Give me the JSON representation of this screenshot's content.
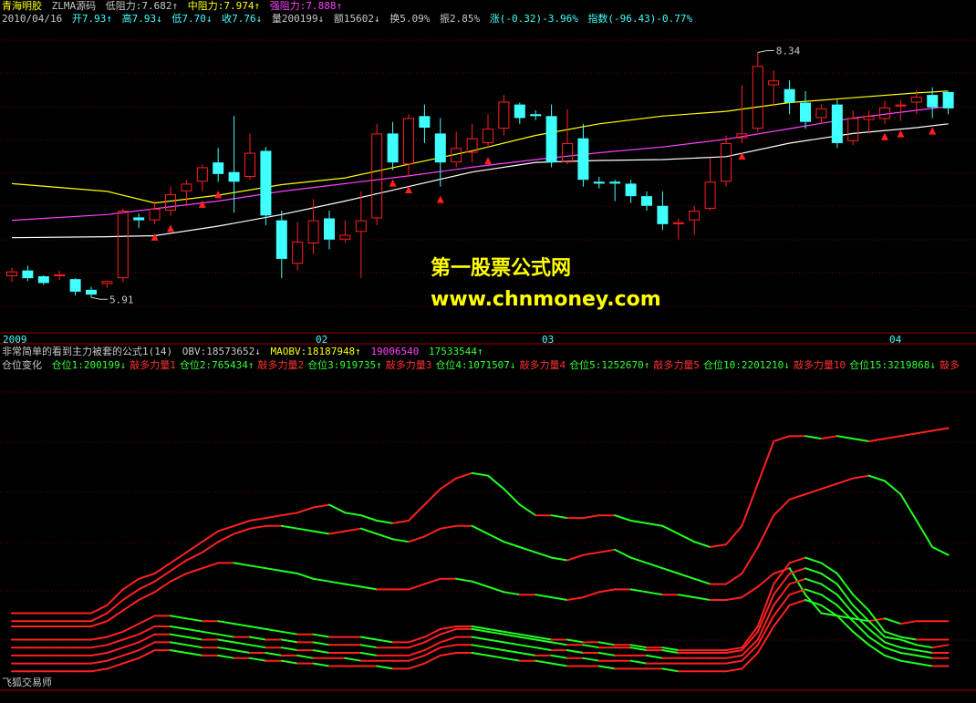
{
  "header1": {
    "stock_name": "青海明胶",
    "indicator_name": "ZLMA源码",
    "low_res": "低阻力:7.682↑",
    "mid_res": "中阻力:7.974↑",
    "strong_res": "强阻力:7.888↑"
  },
  "header2": {
    "date": "2010/04/16",
    "open": "开7.93↑",
    "high": "高7.93↓",
    "low": "低7.70↓",
    "close": "收7.76↓",
    "volume": "量200199↓",
    "amount": "额15602↓",
    "turnover": "换5.09%",
    "amplitude": "振2.85%",
    "change": "涨(-0.32)-3.96%",
    "index": "指数(-96.43)-0.77%"
  },
  "header3": {
    "formula": "非常简单的看到主力被套的公式1(14)",
    "obv": "OBV:18573652↓",
    "maobv": "MAOBV:18187948↑",
    "v1": "19006540",
    "v2": "17533544↑"
  },
  "header4": {
    "title": "仓位变化",
    "items": [
      {
        "text": "仓位1:200199↓",
        "color": "g"
      },
      {
        "text": "敲多力量1",
        "color": "r"
      },
      {
        "text": "仓位2:765434↑",
        "color": "g"
      },
      {
        "text": "敲多力量2",
        "color": "r"
      },
      {
        "text": "仓位3:919735↑",
        "color": "g"
      },
      {
        "text": "敲多力量3",
        "color": "r"
      },
      {
        "text": "仓位4:1071507↓",
        "color": "g"
      },
      {
        "text": "敲多力量4",
        "color": "r"
      },
      {
        "text": "仓位5:1252670↑",
        "color": "g"
      },
      {
        "text": "敲多力量5",
        "color": "r"
      },
      {
        "text": "仓位10:2201210↓",
        "color": "g"
      },
      {
        "text": "敲多力量10",
        "color": "r"
      },
      {
        "text": "仓位15:3219868↓",
        "color": "g"
      },
      {
        "text": "敲多",
        "color": "r"
      }
    ]
  },
  "watermark": {
    "line1": "第一股票公式网",
    "line2": "www.chnmoney.com"
  },
  "footer": "飞狐交易师",
  "chart_data": [
    {
      "type": "candlestick",
      "price_labels": {
        "high": "8.34",
        "low": "5.91"
      },
      "x_labels": [
        "2009",
        "02",
        "03",
        "04"
      ],
      "ylim": [
        5.5,
        8.6
      ],
      "colors": {
        "up": "#ff2020",
        "down": "#40ffff",
        "ma_short": "#ffff00",
        "ma_mid": "#ff40ff",
        "ma_long": "#ffffff",
        "marker": "#ff2020"
      },
      "candles": [
        [
          6.02,
          6.07,
          6.11,
          5.96
        ],
        [
          6.08,
          6.0,
          6.13,
          5.97
        ],
        [
          6.02,
          5.95,
          6.03,
          5.93
        ],
        [
          6.02,
          6.04,
          6.08,
          5.98
        ],
        [
          5.99,
          5.86,
          6.0,
          5.82
        ],
        [
          5.88,
          5.83,
          5.91,
          5.8
        ],
        [
          5.94,
          5.97,
          5.98,
          5.9
        ],
        [
          6.0,
          6.7,
          6.72,
          5.96
        ],
        [
          6.63,
          6.6,
          6.67,
          6.52
        ],
        [
          6.6,
          6.72,
          6.8,
          6.56
        ],
        [
          6.7,
          6.87,
          6.95,
          6.65
        ],
        [
          6.9,
          6.98,
          7.02,
          6.75
        ],
        [
          7.0,
          7.15,
          7.18,
          6.9
        ],
        [
          7.2,
          7.08,
          7.35,
          7.0
        ],
        [
          7.1,
          7.0,
          7.68,
          6.68
        ],
        [
          7.05,
          7.3,
          7.5,
          7.02
        ],
        [
          7.32,
          6.65,
          7.36,
          6.55
        ],
        [
          6.6,
          6.2,
          6.7,
          6.0
        ],
        [
          6.15,
          6.38,
          6.58,
          6.08
        ],
        [
          6.36,
          6.6,
          6.82,
          6.25
        ],
        [
          6.62,
          6.4,
          6.7,
          6.3
        ],
        [
          6.4,
          6.45,
          6.6,
          6.37
        ],
        [
          6.48,
          6.6,
          6.9,
          6.0
        ],
        [
          6.62,
          7.5,
          7.6,
          6.55
        ],
        [
          7.5,
          7.2,
          7.62,
          7.12
        ],
        [
          7.18,
          7.66,
          7.7,
          7.05
        ],
        [
          7.68,
          7.56,
          7.8,
          7.4
        ],
        [
          7.5,
          7.2,
          7.66,
          6.95
        ],
        [
          7.2,
          7.35,
          7.52,
          7.15
        ],
        [
          7.3,
          7.45,
          7.6,
          7.2
        ],
        [
          7.4,
          7.55,
          7.7,
          7.35
        ],
        [
          7.55,
          7.83,
          7.9,
          7.48
        ],
        [
          7.8,
          7.66,
          7.82,
          7.6
        ],
        [
          7.7,
          7.68,
          7.74,
          7.64
        ],
        [
          7.68,
          7.2,
          7.8,
          7.15
        ],
        [
          7.2,
          7.4,
          7.75,
          7.18
        ],
        [
          7.45,
          7.02,
          7.6,
          6.95
        ],
        [
          7.0,
          6.98,
          7.05,
          6.93
        ],
        [
          7.0,
          6.98,
          7.02,
          6.8
        ],
        [
          6.98,
          6.85,
          7.02,
          6.78
        ],
        [
          6.85,
          6.75,
          6.9,
          6.7
        ],
        [
          6.75,
          6.56,
          6.9,
          6.5
        ],
        [
          6.56,
          6.58,
          6.62,
          6.4
        ],
        [
          6.6,
          6.7,
          6.75,
          6.45
        ],
        [
          6.72,
          7.0,
          7.25,
          6.7
        ],
        [
          7.0,
          7.4,
          7.48,
          6.95
        ],
        [
          7.45,
          7.5,
          8.0,
          7.4
        ],
        [
          7.55,
          8.2,
          8.34,
          7.52
        ],
        [
          8.0,
          8.05,
          8.15,
          7.8
        ],
        [
          7.96,
          7.82,
          8.05,
          7.7
        ],
        [
          7.82,
          7.62,
          7.94,
          7.55
        ],
        [
          7.66,
          7.76,
          7.8,
          7.6
        ],
        [
          7.8,
          7.4,
          7.85,
          7.35
        ],
        [
          7.42,
          7.66,
          7.74,
          7.38
        ],
        [
          7.64,
          7.68,
          7.74,
          7.5
        ],
        [
          7.65,
          7.77,
          7.84,
          7.6
        ],
        [
          7.78,
          7.8,
          7.85,
          7.63
        ],
        [
          7.82,
          7.88,
          7.95,
          7.7
        ],
        [
          7.9,
          7.77,
          7.98,
          7.66
        ],
        [
          7.93,
          7.76,
          7.93,
          7.7
        ]
      ],
      "ma_short": [
        [
          0,
          6.98
        ],
        [
          6,
          6.9
        ],
        [
          9,
          6.78
        ],
        [
          13,
          6.86
        ],
        [
          17,
          6.97
        ],
        [
          21,
          7.04
        ],
        [
          25,
          7.18
        ],
        [
          29,
          7.32
        ],
        [
          33,
          7.48
        ],
        [
          37,
          7.6
        ],
        [
          41,
          7.68
        ],
        [
          45,
          7.73
        ],
        [
          49,
          7.82
        ],
        [
          53,
          7.87
        ],
        [
          57,
          7.92
        ],
        [
          59,
          7.94
        ]
      ],
      "ma_mid": [
        [
          0,
          6.6
        ],
        [
          6,
          6.66
        ],
        [
          9,
          6.72
        ],
        [
          13,
          6.8
        ],
        [
          17,
          6.9
        ],
        [
          21,
          6.98
        ],
        [
          25,
          7.06
        ],
        [
          29,
          7.15
        ],
        [
          33,
          7.23
        ],
        [
          37,
          7.3
        ],
        [
          41,
          7.36
        ],
        [
          45,
          7.44
        ],
        [
          49,
          7.55
        ],
        [
          53,
          7.66
        ],
        [
          57,
          7.74
        ],
        [
          59,
          7.78
        ]
      ],
      "ma_long": [
        [
          0,
          6.42
        ],
        [
          6,
          6.43
        ],
        [
          9,
          6.44
        ],
        [
          13,
          6.54
        ],
        [
          17,
          6.66
        ],
        [
          21,
          6.8
        ],
        [
          25,
          6.95
        ],
        [
          29,
          7.1
        ],
        [
          33,
          7.2
        ],
        [
          37,
          7.22
        ],
        [
          41,
          7.23
        ],
        [
          45,
          7.26
        ],
        [
          49,
          7.4
        ],
        [
          53,
          7.5
        ],
        [
          57,
          7.56
        ],
        [
          59,
          7.6
        ]
      ],
      "markers": [
        9,
        10,
        12,
        13,
        24,
        25,
        27,
        30,
        46,
        55,
        56,
        58
      ]
    },
    {
      "type": "line",
      "ylim": [
        0,
        100
      ],
      "colors": {
        "rising": "#ff2020",
        "falling": "#20ff20"
      },
      "series": [
        {
          "values": [
            25,
            25,
            25,
            25,
            25,
            25,
            28,
            34,
            38,
            40,
            44,
            48,
            52,
            56,
            58,
            60,
            61,
            62,
            63,
            65,
            66,
            63,
            62,
            60,
            59,
            60,
            66,
            72,
            76,
            78,
            77,
            72,
            66,
            62,
            62,
            61,
            61,
            62,
            62,
            60,
            59,
            58,
            55,
            52,
            50,
            51,
            58,
            74,
            90,
            92,
            92,
            91,
            92,
            91,
            90,
            91,
            92,
            93,
            94,
            95
          ]
        },
        {
          "values": [
            22,
            22,
            22,
            22,
            22,
            22,
            25,
            30,
            34,
            37,
            41,
            45,
            48,
            52,
            55,
            57,
            58,
            58,
            57,
            56,
            55,
            56,
            57,
            55,
            53,
            52,
            54,
            57,
            58,
            58,
            55,
            52,
            50,
            48,
            46,
            45,
            47,
            48,
            49,
            46,
            44,
            42,
            40,
            38,
            36,
            36,
            40,
            50,
            62,
            68,
            70,
            72,
            74,
            76,
            77,
            75,
            70,
            60,
            50,
            47
          ]
        },
        {
          "values": [
            20,
            20,
            20,
            20,
            20,
            20,
            22,
            26,
            30,
            33,
            37,
            40,
            42,
            44,
            44,
            43,
            42,
            41,
            40,
            38,
            37,
            36,
            35,
            34,
            34,
            34,
            36,
            38,
            38,
            37,
            35,
            33,
            32,
            32,
            31,
            30,
            31,
            33,
            34,
            34,
            33,
            32,
            32,
            31,
            30,
            30,
            31,
            35,
            40,
            42,
            32,
            25,
            24,
            23,
            22,
            23,
            21,
            22,
            22,
            22
          ]
        },
        {
          "values": [
            15,
            15,
            15,
            15,
            15,
            15,
            16,
            18,
            21,
            24,
            24,
            23,
            22,
            22,
            21,
            20,
            19,
            18,
            17,
            17,
            16,
            16,
            16,
            15,
            14,
            14,
            16,
            19,
            20,
            20,
            19,
            18,
            17,
            16,
            15,
            15,
            14,
            14,
            13,
            13,
            12,
            12,
            11,
            11,
            11,
            11,
            12,
            20,
            36,
            44,
            46,
            44,
            40,
            32,
            26,
            18,
            16,
            15,
            15,
            15
          ]
        },
        {
          "values": [
            12,
            12,
            12,
            12,
            12,
            12,
            13,
            15,
            17,
            20,
            20,
            19,
            18,
            17,
            16,
            16,
            15,
            15,
            14,
            14,
            13,
            13,
            13,
            12,
            12,
            12,
            14,
            17,
            19,
            19,
            18,
            17,
            16,
            15,
            14,
            13,
            13,
            12,
            12,
            12,
            11,
            11,
            10,
            10,
            10,
            10,
            11,
            18,
            32,
            40,
            42,
            40,
            36,
            28,
            22,
            16,
            15,
            13,
            12,
            13
          ]
        },
        {
          "values": [
            9,
            9,
            9,
            9,
            9,
            9,
            10,
            12,
            14,
            17,
            17,
            16,
            15,
            15,
            14,
            13,
            12,
            12,
            11,
            11,
            10,
            10,
            10,
            9,
            9,
            9,
            11,
            14,
            16,
            16,
            15,
            14,
            13,
            12,
            11,
            11,
            10,
            10,
            9,
            9,
            9,
            8,
            8,
            8,
            8,
            8,
            9,
            15,
            28,
            36,
            38,
            36,
            32,
            25,
            19,
            14,
            12,
            11,
            10,
            10
          ]
        },
        {
          "values": [
            6,
            6,
            6,
            6,
            6,
            6,
            7,
            9,
            11,
            14,
            14,
            13,
            12,
            12,
            11,
            10,
            10,
            9,
            9,
            8,
            8,
            8,
            7,
            7,
            7,
            7,
            9,
            12,
            13,
            13,
            12,
            11,
            10,
            9,
            9,
            8,
            8,
            7,
            7,
            7,
            6,
            6,
            6,
            6,
            6,
            6,
            7,
            13,
            24,
            32,
            34,
            32,
            28,
            22,
            16,
            12,
            10,
            9,
            8,
            8
          ]
        },
        {
          "values": [
            3,
            3,
            3,
            3,
            3,
            3,
            4,
            6,
            8,
            11,
            11,
            10,
            9,
            9,
            8,
            8,
            7,
            7,
            6,
            6,
            5,
            5,
            5,
            5,
            4,
            4,
            6,
            9,
            10,
            10,
            9,
            8,
            7,
            7,
            6,
            5,
            5,
            5,
            4,
            4,
            4,
            4,
            3,
            3,
            3,
            3,
            4,
            10,
            20,
            28,
            30,
            28,
            24,
            18,
            13,
            9,
            7,
            6,
            5,
            5
          ]
        }
      ]
    }
  ]
}
